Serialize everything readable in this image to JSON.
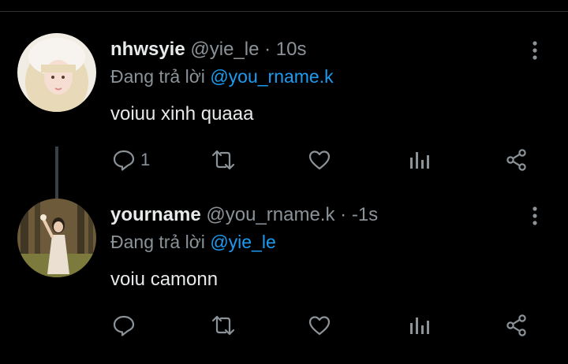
{
  "tweets": [
    {
      "name": "nhwsyie",
      "handle": "@yie_le",
      "separator": "·",
      "time": "10s",
      "replying_prefix": "Đang trả lời",
      "replying_to": "@you_rname.k",
      "text": "voiuu xinh quaaa",
      "reply_count": "1",
      "avatar_colors": {
        "bg": "#f2ede4",
        "hair": "#e8d9b8",
        "hat": "#f7f3ee",
        "skin": "#f6dfd2"
      }
    },
    {
      "name": "yourname",
      "handle": "@you_rname.k",
      "separator": "·",
      "time": "-1s",
      "replying_prefix": "Đang trả lời",
      "replying_to": "@yie_le",
      "text": "voiu camonn",
      "reply_count": "",
      "avatar_colors": {
        "bg": "#6c5a3a",
        "trees": "#3f3724",
        "dress": "#eadfd0",
        "skin": "#e9cbb2"
      }
    }
  ],
  "icons": [
    "reply-icon",
    "retweet-icon",
    "like-icon",
    "views-icon",
    "share-icon",
    "more-icon"
  ],
  "colors": {
    "background": "#000000",
    "text": "#e7e9ea",
    "secondary": "#8b9298",
    "accent": "#1d9bf0"
  }
}
